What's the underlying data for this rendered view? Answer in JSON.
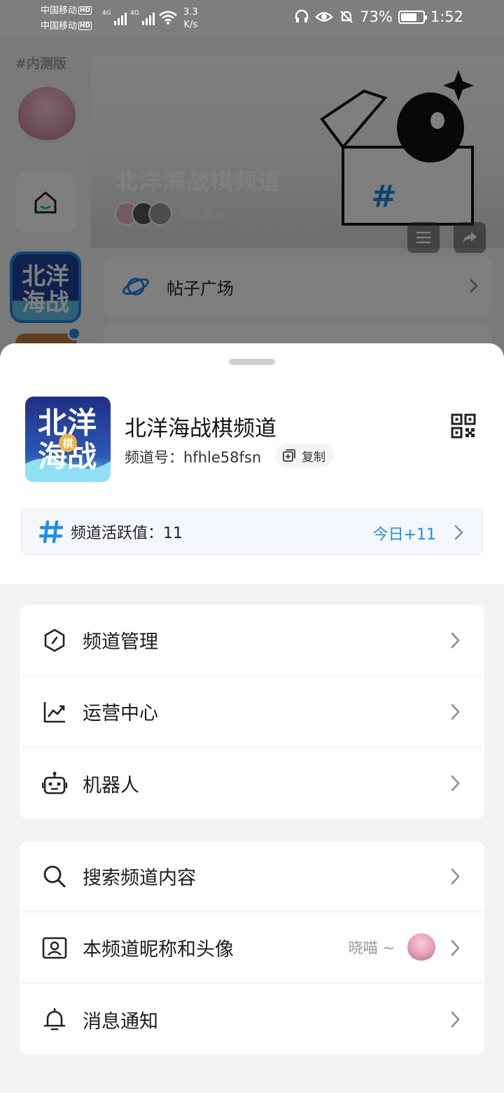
{
  "status_bar": {
    "carrier1": "中国移动",
    "carrier2": "中国移动",
    "hd": "HD",
    "net": "4G",
    "speed_value": "3.3",
    "speed_unit": "K/s",
    "battery": "73%",
    "battery_level": 0.73,
    "time": "1:52"
  },
  "background": {
    "beta_tag": "#内测版",
    "banner_title": "北洋海战棋频道",
    "member_count": "9成员 ▸",
    "post_square": "帖子广场"
  },
  "channel": {
    "name": "北洋海战棋频道",
    "id_label": "频道号：hfhle58fsn",
    "copy_label": "复制",
    "logo_text_1": "北洋",
    "logo_text_2": "海战",
    "logo_badge": "棋",
    "activity_label": "频道活跃值：11",
    "activity_today": "今日+11"
  },
  "menu_group_1": [
    {
      "label": "频道管理",
      "icon": "hexagon-icon"
    },
    {
      "label": "运营中心",
      "icon": "chart-icon"
    },
    {
      "label": "机器人",
      "icon": "robot-icon"
    }
  ],
  "menu_group_2": [
    {
      "label": "搜索频道内容",
      "icon": "search-icon"
    },
    {
      "label": "本频道昵称和头像",
      "icon": "profile-card-icon",
      "value": "晓喵 ~"
    },
    {
      "label": "消息通知",
      "icon": "bell-icon"
    }
  ],
  "colors": {
    "accent": "#1d8fe6",
    "text_primary": "#1c1c1c",
    "text_secondary": "#999999",
    "sheet_bg": "#f2f3f5"
  }
}
